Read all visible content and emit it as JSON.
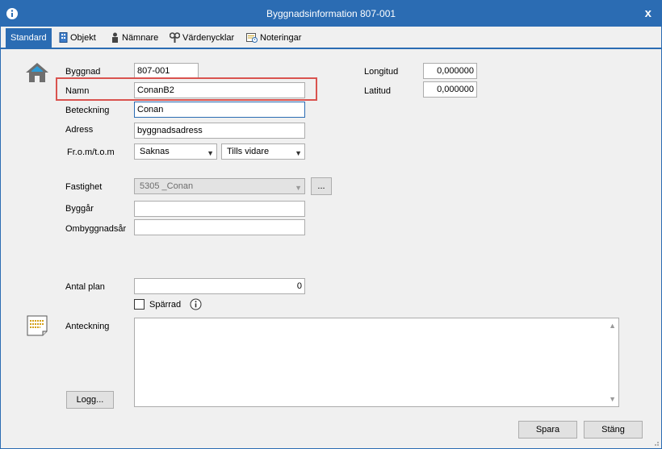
{
  "window": {
    "title": "Byggnadsinformation 807-001",
    "close_label": "x"
  },
  "tabs": [
    {
      "label": "Standard"
    },
    {
      "label": "Objekt"
    },
    {
      "label": "Nämnare"
    },
    {
      "label": "Värdenycklar"
    },
    {
      "label": "Noteringar"
    }
  ],
  "form": {
    "byggnad": {
      "label": "Byggnad",
      "value": "807-001"
    },
    "namn": {
      "label": "Namn",
      "value": "ConanB2"
    },
    "beteckning": {
      "label": "Beteckning",
      "value": "Conan"
    },
    "adress": {
      "label": "Adress",
      "value": "byggnadsadress"
    },
    "from_tom": {
      "label": "Fr.o.m/t.o.m",
      "from_value": "Saknas",
      "tom_value": "Tills vidare"
    },
    "longitud": {
      "label": "Longitud",
      "value": "0,000000"
    },
    "latitud": {
      "label": "Latitud",
      "value": "0,000000"
    },
    "fastighet": {
      "label": "Fastighet",
      "value": "5305 _Conan",
      "browse_label": "..."
    },
    "byggar": {
      "label": "Byggår",
      "value": ""
    },
    "ombyggnadsar": {
      "label": "Ombyggnadsår",
      "value": ""
    },
    "antal_plan": {
      "label": "Antal plan",
      "value": "0"
    },
    "sparrad": {
      "label": "Spärrad",
      "checked": false
    },
    "anteckning": {
      "label": "Anteckning",
      "value": ""
    }
  },
  "buttons": {
    "logg": "Logg...",
    "spara": "Spara",
    "stang": "Stäng"
  },
  "colors": {
    "accent": "#2b6cb3",
    "highlight": "#d9534f"
  }
}
